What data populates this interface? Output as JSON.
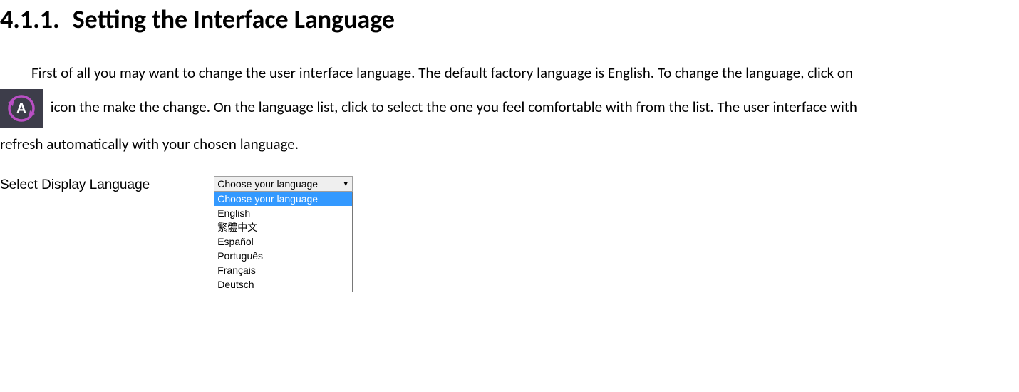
{
  "heading": {
    "number": "4.1.1.",
    "title": "Setting the Interface Language"
  },
  "paragraph": {
    "line1": "First of all you may want to change the user interface language. The default factory language is English. To change the language, click on",
    "line2": " icon the make the change. On the language list, click to select the one you feel comfortable with from the list. The user interface with",
    "line3": "refresh automatically with your chosen language."
  },
  "dropdown": {
    "label": "Select Display Language",
    "selected": "Choose your language",
    "options": [
      "Choose your language",
      "English",
      "繁體中文",
      "Español",
      "Português",
      "Français",
      "Deutsch"
    ]
  }
}
